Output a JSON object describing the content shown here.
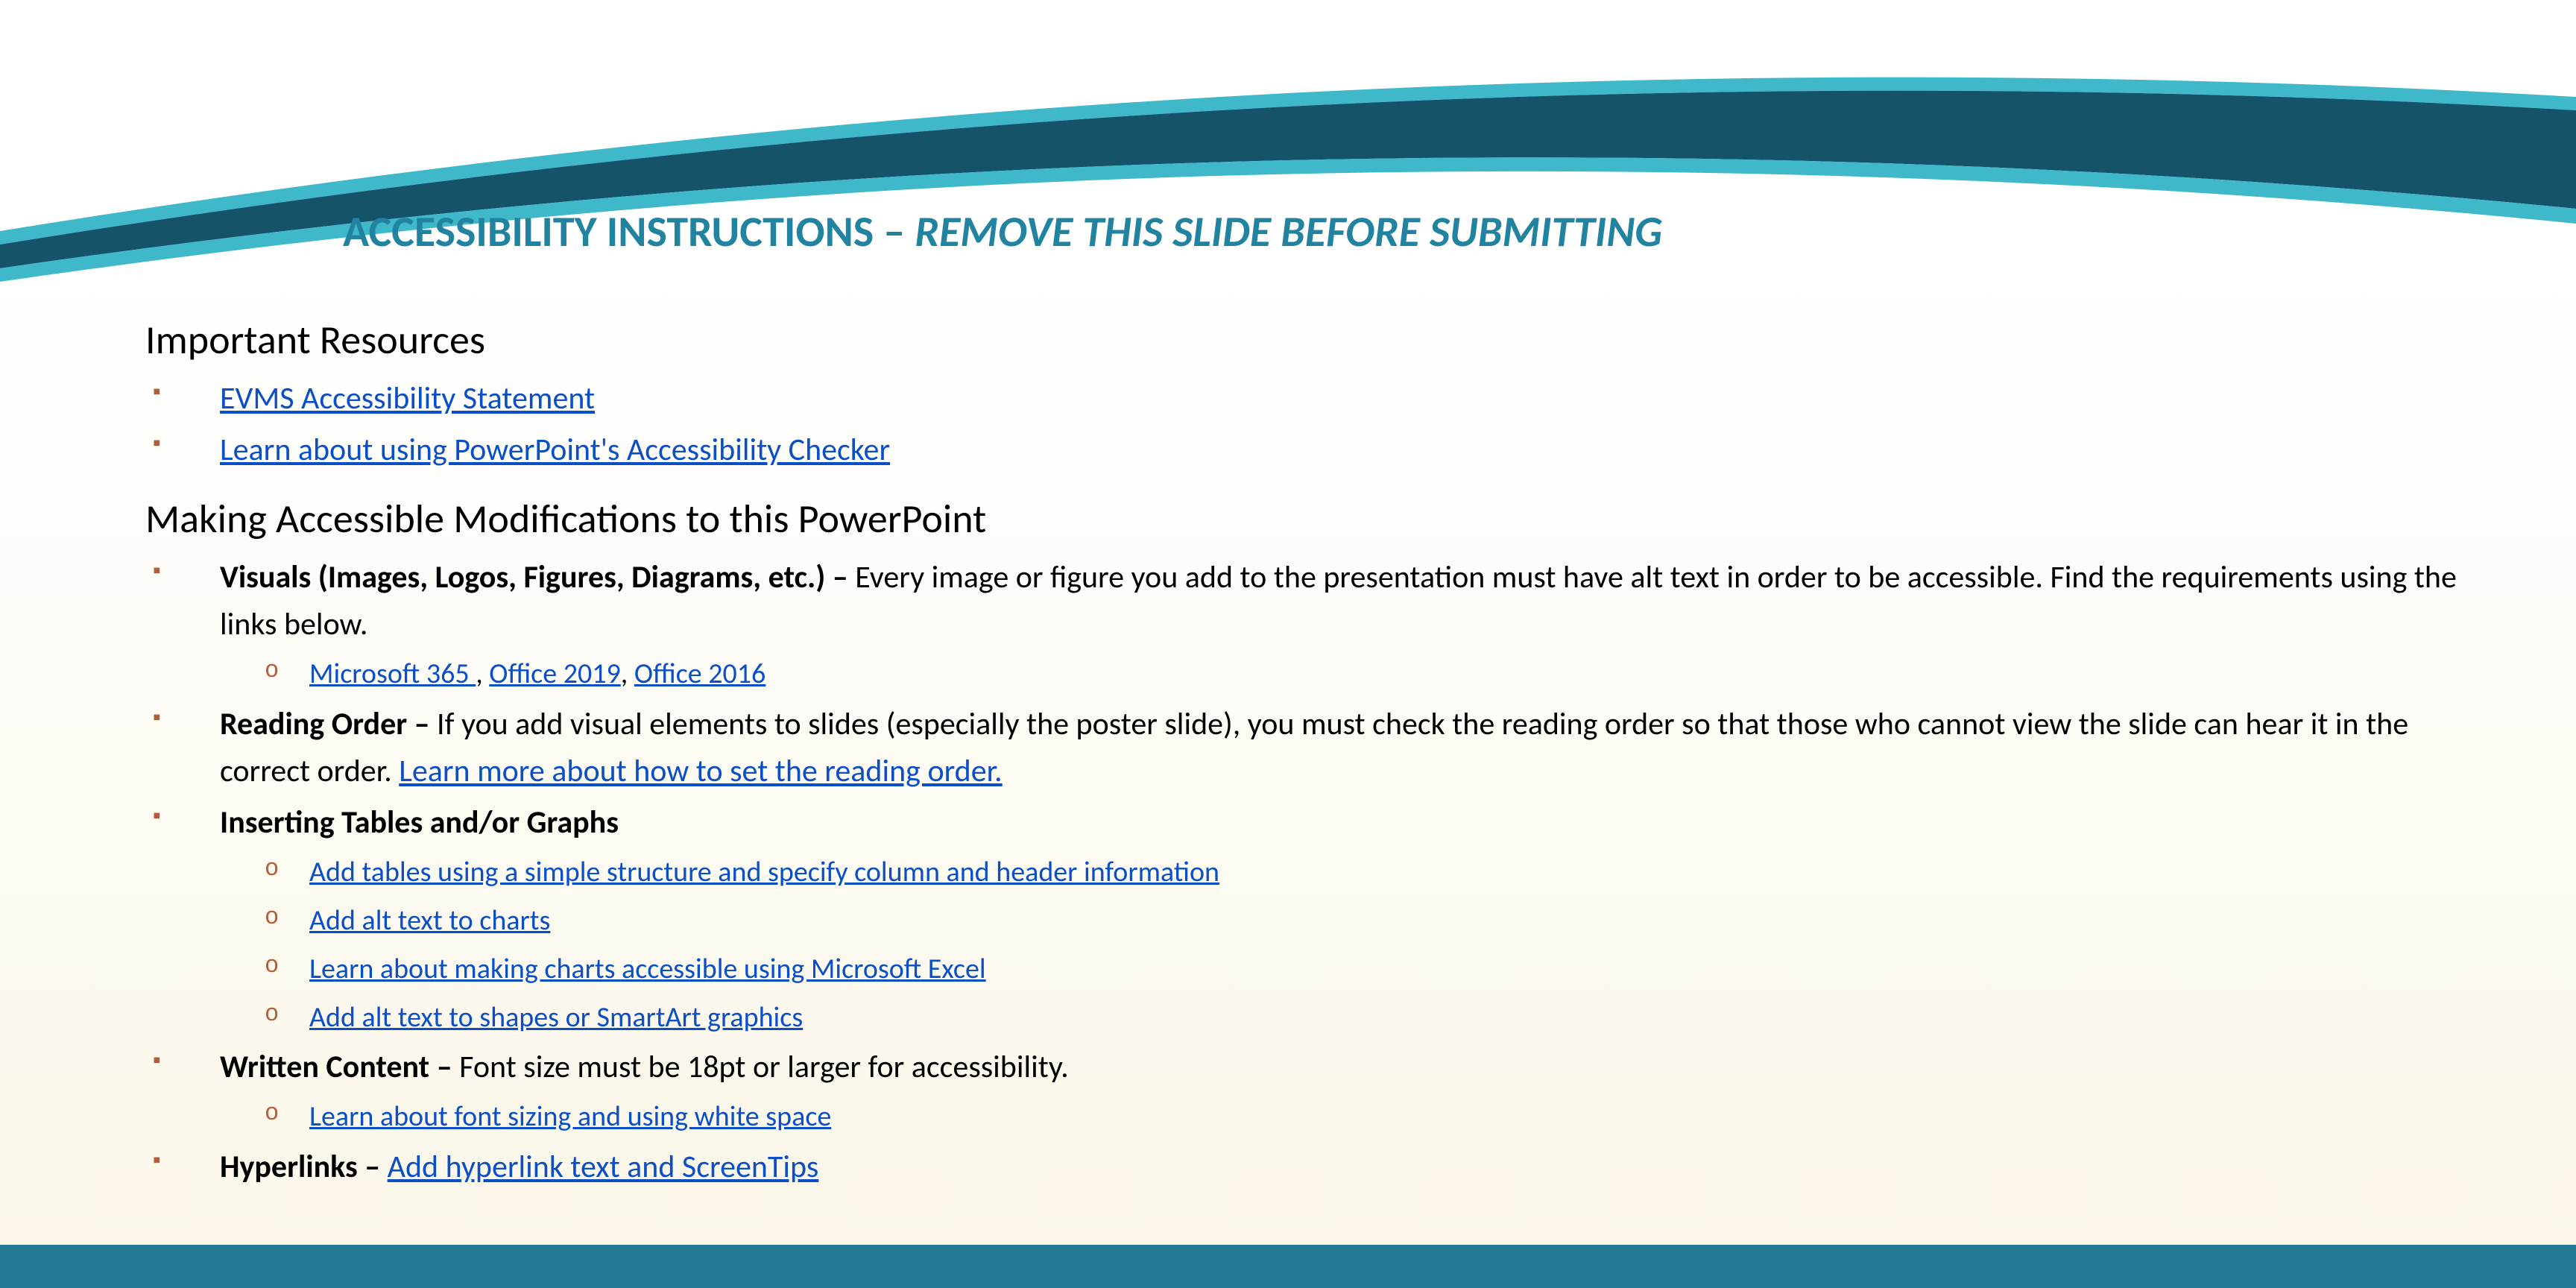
{
  "title": {
    "main": "ACCESSIBILITY INSTRUCTIONS – ",
    "em": "REMOVE THIS SLIDE BEFORE SUBMITTING"
  },
  "sections": {
    "resources": {
      "heading": "Important Resources",
      "links": {
        "evms": "EVMS Accessibility Statement ",
        "checker": "Learn about using PowerPoint's Accessibility Checker  "
      }
    },
    "modifications": {
      "heading": "Making Accessible Modifications to this PowerPoint",
      "visuals": {
        "label": "Visuals (Images, Logos, Figures, Diagrams, etc.) – ",
        "text": "Every image or figure you add to the presentation   must have alt text in order to be accessible. Find the requirements using the links below.",
        "links": {
          "m365": "Microsoft 365 ",
          "o2019": "Office 2019",
          "o2016": "Office 2016"
        },
        "commaSep": ", "
      },
      "readingOrder": {
        "label": "Reading Order – ",
        "text": "If you add visual elements to slides (especially the poster slide), you must check the reading order so that those who cannot view the slide can hear it in the correct order.  ",
        "link": "Learn more about how to set the reading order. "
      },
      "tables": {
        "label": "Inserting Tables and/or Graphs",
        "links": {
          "structure": "Add tables using a simple structure and specify column and header information   ",
          "altcharts": "Add alt text to charts ",
          "excel": "Learn about making charts accessible using Microsoft Excel  ",
          "shapes": "Add alt text to shapes or SmartArt graphics  "
        }
      },
      "written": {
        "label": "Written Content – ",
        "text": "Font size must be 18pt or larger for accessibility.",
        "link": "Learn about font sizing and using white space  "
      },
      "hyperlinks": {
        "label": "Hyperlinks – ",
        "link": "Add hyperlink text and ScreenTips "
      }
    }
  }
}
